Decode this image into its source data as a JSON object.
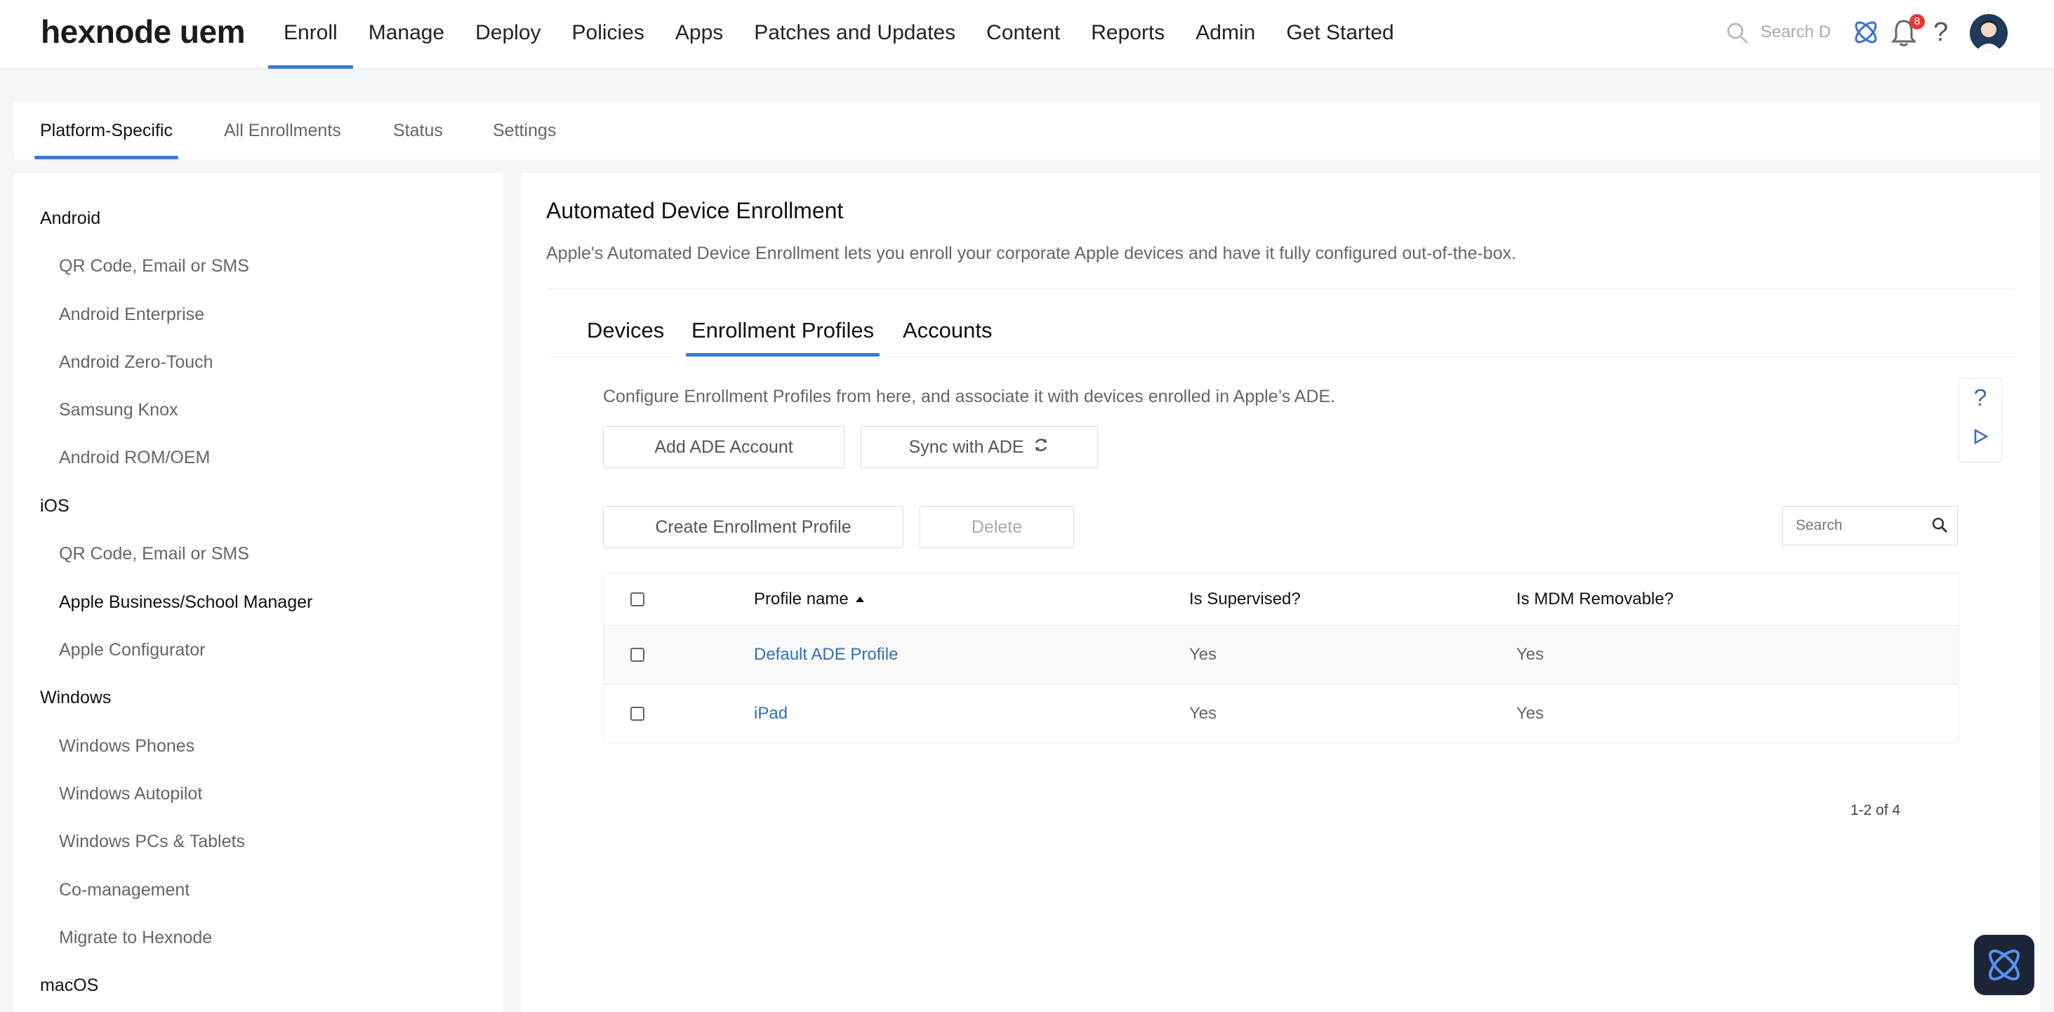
{
  "header": {
    "logo": "hexnode uem",
    "nav": [
      "Enroll",
      "Manage",
      "Deploy",
      "Policies",
      "Apps",
      "Patches and Updates",
      "Content",
      "Reports",
      "Admin",
      "Get Started"
    ],
    "active_nav": "Enroll",
    "search_placeholder": "Search De",
    "notification_count": "8"
  },
  "subtabs": [
    "Platform-Specific",
    "All Enrollments",
    "Status",
    "Settings"
  ],
  "sidebar": {
    "groups": [
      {
        "label": "Android",
        "items": [
          "QR Code, Email or SMS",
          "Android Enterprise",
          "Android Zero-Touch",
          "Samsung Knox",
          "Android ROM/OEM"
        ]
      },
      {
        "label": "iOS",
        "items": [
          "QR Code, Email or SMS",
          "Apple Business/School Manager",
          "Apple Configurator"
        ]
      },
      {
        "label": "Windows",
        "items": [
          "Windows Phones",
          "Windows Autopilot",
          "Windows PCs & Tablets",
          "Co-management",
          "Migrate to Hexnode"
        ]
      },
      {
        "label": "macOS",
        "items": []
      }
    ],
    "selected": "Apple Business/School Manager"
  },
  "main": {
    "title": "Automated Device Enrollment",
    "description": "Apple's Automated Device Enrollment lets you enroll your corporate Apple devices and have it fully configured out-of-the-box.",
    "tabs": [
      "Devices",
      "Enrollment Profiles",
      "Accounts"
    ],
    "active_tab": "Enrollment Profiles",
    "configure_text": "Configure Enrollment Profiles from here, and associate it with devices enrolled in Apple’s ADE.",
    "add_ade_button": "Add ADE Account",
    "sync_button": "Sync with ADE",
    "create_button": "Create Enrollment Profile",
    "delete_button": "Delete",
    "search_placeholder": "Search",
    "help": "?",
    "table": {
      "columns": [
        "Profile name",
        "Is Supervised?",
        "Is MDM Removable?"
      ],
      "rows": [
        {
          "name": "Default ADE Profile",
          "supervised": "Yes",
          "removable": "Yes"
        },
        {
          "name": "iPad",
          "supervised": "Yes",
          "removable": "Yes"
        }
      ]
    },
    "pagination": "1-2 of 4"
  },
  "colors": {
    "accent": "#3a7bd5",
    "link": "#2f6fb8",
    "badge": "#e53935"
  }
}
